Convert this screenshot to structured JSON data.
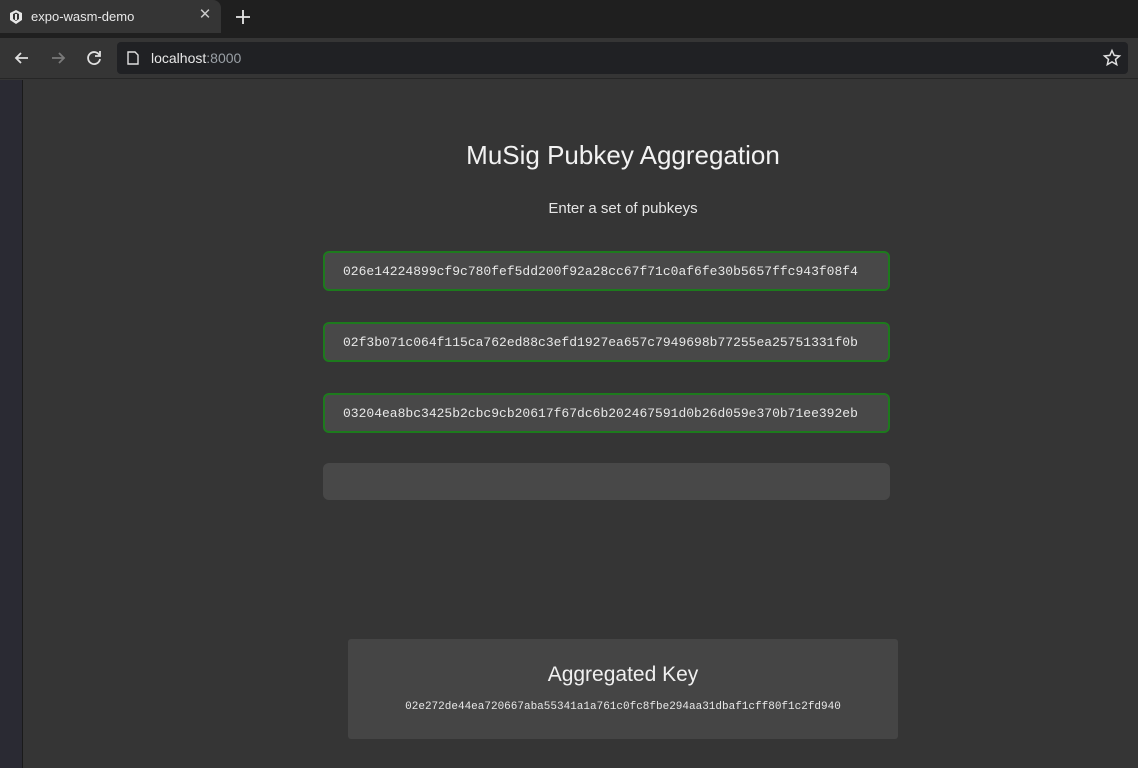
{
  "browser": {
    "tab_title": "expo-wasm-demo",
    "tab_close_icon": "close-icon",
    "new_tab_icon": "plus-icon",
    "back_icon": "arrow-left-icon",
    "forward_icon": "arrow-right-icon",
    "reload_icon": "reload-icon",
    "url_host": "localhost",
    "url_port": ":8000",
    "bookmark_icon": "star-icon"
  },
  "page": {
    "title": "MuSig Pubkey Aggregation",
    "subtitle": "Enter a set of pubkeys",
    "pubkeys": [
      "026e14224899cf9c780fef5dd200f92a28cc67f71c0af6fe30b5657ffc943f08f4",
      "02f3b071c064f115ca762ed88c3efd1927ea657c7949698b77255ea25751331f0b",
      "03204ea8bc3425b2cbc9cb20617f67dc6b202467591d0b26d059e370b71ee392eb"
    ],
    "new_pubkey_value": "",
    "result": {
      "title": "Aggregated Key",
      "key": "02e272de44ea720667aba55341a1a761c0fc8fbe294aa31dbaf1cff80f1c2fd940"
    }
  },
  "colors": {
    "valid_border": "#1d7a1d",
    "background": "#353535",
    "input_background": "#484848"
  }
}
